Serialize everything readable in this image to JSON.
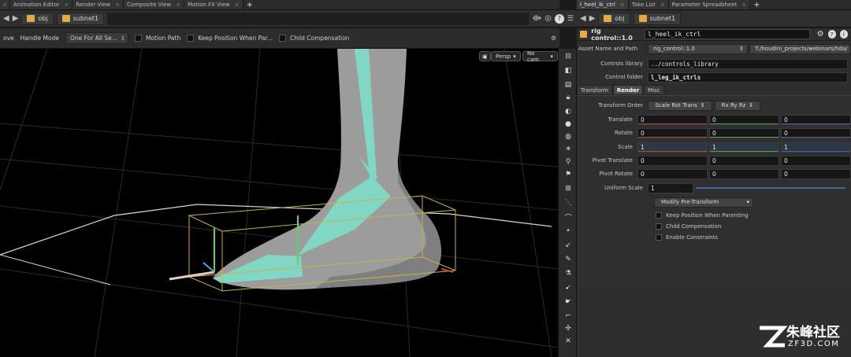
{
  "left_tabs": [
    {
      "label": "Animation Editor"
    },
    {
      "label": "Render View"
    },
    {
      "label": "Composite View"
    },
    {
      "label": "Motion FX View"
    }
  ],
  "right_tabs": [
    {
      "label": "l_heel_ik_ctrl"
    },
    {
      "label": "Take List"
    },
    {
      "label": "Parameter Spreadsheet"
    }
  ],
  "tab_close": "×",
  "tab_plus": "+",
  "left_path": {
    "crumbs": [
      "obj",
      "subnet1"
    ]
  },
  "right_path": {
    "crumbs": [
      "obj",
      "subnet1"
    ]
  },
  "viewer_toolbar": {
    "mode_label": "ove",
    "handle_mode_label": "Handle Mode",
    "handle_mode_value": "One For All Se...",
    "motion_path": "Motion Path",
    "keep_position": "Keep Position When Par...",
    "child_comp": "Child Compensation"
  },
  "viewport": {
    "persp": "Persp",
    "nocam": "No cam"
  },
  "params": {
    "node_type": "rig control::1.0",
    "node_name": "l_heel_ik_ctrl",
    "asset_label": "Asset Name and Path",
    "asset_name": "rig_control::1.0",
    "asset_path": "T:/houdini_projects/webinars/hda/",
    "controls_library_label": "Controls library",
    "controls_library": "../controls_library",
    "control_folder_label": "Control folder",
    "control_folder": "l_leg_ik_ctrls",
    "tabs": [
      "Transform",
      "Render",
      "Misc"
    ],
    "transform_order_label": "Transform Order",
    "transform_order": "Scale Rot Trans",
    "rotate_order": "Rx Ry Rz",
    "translate_label": "Translate",
    "translate": [
      "0",
      "0",
      "0"
    ],
    "rotate_label": "Rotate",
    "rotate": [
      "0",
      "0",
      "0"
    ],
    "scale_label": "Scale",
    "scale": [
      "1",
      "1",
      "1"
    ],
    "pivot_translate_label": "Pivot Translate",
    "pivot_translate": [
      "0",
      "0",
      "0"
    ],
    "pivot_rotate_label": "Pivot Rotate",
    "pivot_rotate": [
      "0",
      "0",
      "0"
    ],
    "uniform_scale_label": "Uniform Scale",
    "uniform_scale": "1",
    "modify_button": "Modify Pre-Transform",
    "keep_position": "Keep Position When Parenting",
    "child_comp": "Child Compensation",
    "enable_constraints": "Enable Constraints"
  },
  "watermark": {
    "brand": "朱峰社区",
    "domain": "ZF3D.COM"
  },
  "colors": {
    "folder_icon": "#e2a948",
    "cyan_geo": "#7fdcc8",
    "bbox_yellow": "#c9b24a",
    "skin_gray": "#9a9a9a"
  }
}
